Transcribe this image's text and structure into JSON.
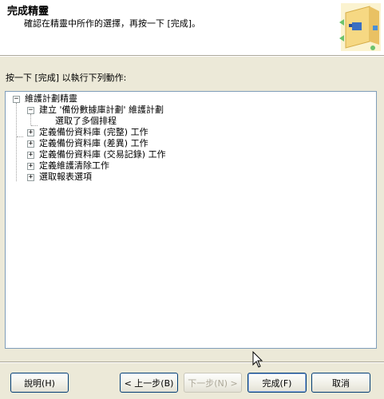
{
  "wizard": {
    "title": "完成精靈",
    "subtitle": "確認在精靈中所作的選擇，再按一下 [完成]。",
    "header_icon": "wizard-folder-icon"
  },
  "instruction": "按一下 [完成] 以執行下列動作:",
  "tree": {
    "root": {
      "label": "維護計劃精靈",
      "expanded": true,
      "children": [
        {
          "label": "建立 '備份數據庫計劃' 維護計劃",
          "expanded": true,
          "children": [
            {
              "label": "選取了多個排程"
            }
          ]
        },
        {
          "label": "定義備份資料庫 (完整) 工作",
          "expanded": false
        },
        {
          "label": "定義備份資料庫 (差異) 工作",
          "expanded": false
        },
        {
          "label": "定義備份資料庫 (交易記錄) 工作",
          "expanded": false
        },
        {
          "label": "定義維護清除工作",
          "expanded": false
        },
        {
          "label": "選取報表選項",
          "expanded": false
        }
      ]
    }
  },
  "buttons": {
    "help": "說明(H)",
    "back": "< 上一步(B)",
    "next": "下一步(N) >",
    "finish": "完成(F)",
    "cancel": "取消"
  },
  "colors": {
    "dialog_bg": "#ece9d8",
    "header_bg": "#ffffff",
    "button_border": "#003c74",
    "disabled_text": "#aca899"
  }
}
